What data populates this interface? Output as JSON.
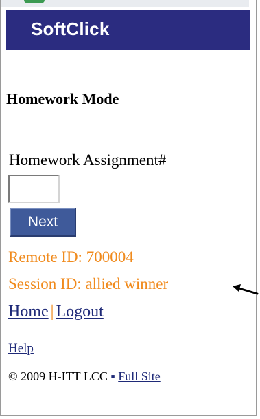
{
  "header": {
    "brand": "SoftClick"
  },
  "page": {
    "title": "Homework Mode"
  },
  "form": {
    "assignment_label": "Homework Assignment#",
    "assignment_value": "",
    "next_label": "Next"
  },
  "info": {
    "remote_id": "Remote ID: 700004",
    "session_id": "Session ID: allied winner"
  },
  "nav": {
    "home": "Home",
    "separator": "|",
    "logout": "Logout",
    "help": "Help"
  },
  "footer": {
    "copyright": "© 2009 H-ITT LCC",
    "bullet": "▪",
    "full_site": "Full Site"
  },
  "colors": {
    "header_bg": "#2b2c80",
    "accent_orange": "#f08a1c",
    "link_blue": "#1f2a78",
    "button_bg": "#3f5a9a"
  }
}
